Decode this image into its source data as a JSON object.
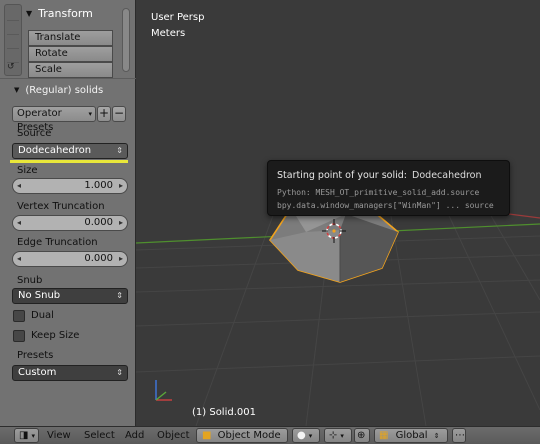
{
  "shelf": {
    "transform": {
      "title": "Transform",
      "buttons": [
        "Translate",
        "Rotate",
        "Scale"
      ]
    },
    "operator": {
      "title": "(Regular) solids",
      "presets_button": "Operator Presets",
      "add_symbol": "+",
      "remove_symbol": "−",
      "source_label": "Source",
      "source_value": "Dodecahedron",
      "size_label": "Size",
      "size_value": "1.000",
      "vertex_trunc_label": "Vertex Truncation",
      "vertex_trunc_value": "0.000",
      "edge_trunc_label": "Edge Truncation",
      "edge_trunc_value": "0.000",
      "snub_label": "Snub",
      "snub_value": "No Snub",
      "dual_label": "Dual",
      "keep_size_label": "Keep Size",
      "presets_label": "Presets",
      "presets_value": "Custom"
    }
  },
  "viewport": {
    "view_name": "User Persp",
    "units": "Meters",
    "object_label": "(1) Solid.001",
    "tooltip": {
      "title": "Starting point of your solid:",
      "value": "Dodecahedron",
      "python": "Python: MESH_OT_primitive_solid_add.source",
      "path": "bpy.data.window_managers[\"WinMan\"] ... source"
    }
  },
  "header": {
    "menus": [
      "View",
      "Select",
      "Add",
      "Object"
    ],
    "mode": "Object Mode",
    "orientation": "Global"
  },
  "colors": {
    "highlight_bar": "#e9e73a",
    "selection_outline": "#f0a21e",
    "grid_x_axis": "#9b3a3a",
    "grid_y_axis": "#4f8f2e"
  },
  "icons": [
    "view3d-editor-icon",
    "object-mode-cube-icon",
    "viewport-shading-sphere-icon",
    "pivot-point-icon",
    "manipulator-icon",
    "axis-gizmo-icon",
    "cursor-crosshair-icon"
  ]
}
